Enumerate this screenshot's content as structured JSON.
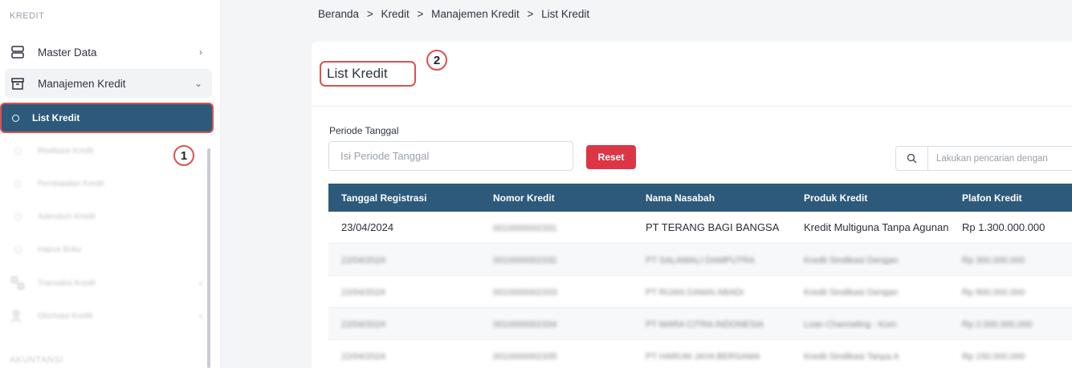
{
  "sidebar": {
    "section_title": "KREDIT",
    "bottom_section_title": "AKUNTANSI",
    "items": [
      {
        "label": "Master Data",
        "icon": "server-icon"
      },
      {
        "label": "Manajemen Kredit",
        "icon": "archive-icon"
      },
      {
        "label": "List Kredit",
        "icon": "circle-icon"
      },
      {
        "label": "Realisasi Kredit",
        "icon": "circle-icon"
      },
      {
        "label": "Pembatalan Kredit",
        "icon": "circle-icon"
      },
      {
        "label": "Adendum Kredit",
        "icon": "circle-icon"
      },
      {
        "label": "Hapus Buku",
        "icon": "circle-icon"
      },
      {
        "label": "Transaksi Kredit",
        "icon": "transaction-icon"
      },
      {
        "label": "Otorisasi Kredit",
        "icon": "authorization-icon"
      }
    ]
  },
  "annotations": {
    "one": "1",
    "two": "2"
  },
  "breadcrumb": [
    "Beranda",
    ">",
    "Kredit",
    ">",
    "Manajemen Kredit",
    ">",
    "List Kredit"
  ],
  "page": {
    "title": "List Kredit",
    "period_label": "Periode Tanggal",
    "period_placeholder": "Isi Periode Tanggal",
    "reset_label": "Reset",
    "search_placeholder": "Lakukan pencarian dengan"
  },
  "table": {
    "headers": [
      "Tanggal Registrasi",
      "Nomor Kredit",
      "Nama Nasabah",
      "Produk Kredit",
      "Plafon Kredit"
    ],
    "rows": [
      [
        "23/04/2024",
        "0010000002331",
        "PT TERANG BAGI BANGSA",
        "Kredit Multiguna Tanpa Agunan",
        "Rp 1.300.000.000"
      ],
      [
        "22/04/2024",
        "0010000002332",
        "PT SALAWALI DAMPUTRA",
        "Kredit Sindikasi Dengan",
        "Rp 300.000.000"
      ],
      [
        "22/04/2024",
        "0010000002333",
        "PT RIJAN DAMAI ABADI",
        "Kredit Sindikasi Dengan",
        "Rp 800.000.000"
      ],
      [
        "22/04/2024",
        "0010000002334",
        "PT MARA CITRA INDONESIA",
        "Loan Channeling - Kom",
        "Rp 2.000.000.000"
      ],
      [
        "22/04/2024",
        "0010000002335",
        "PT HARUM JAYA BERSAMA",
        "Kredit Sindikasi Tanpa A",
        "Rp 150.000.000"
      ]
    ]
  }
}
